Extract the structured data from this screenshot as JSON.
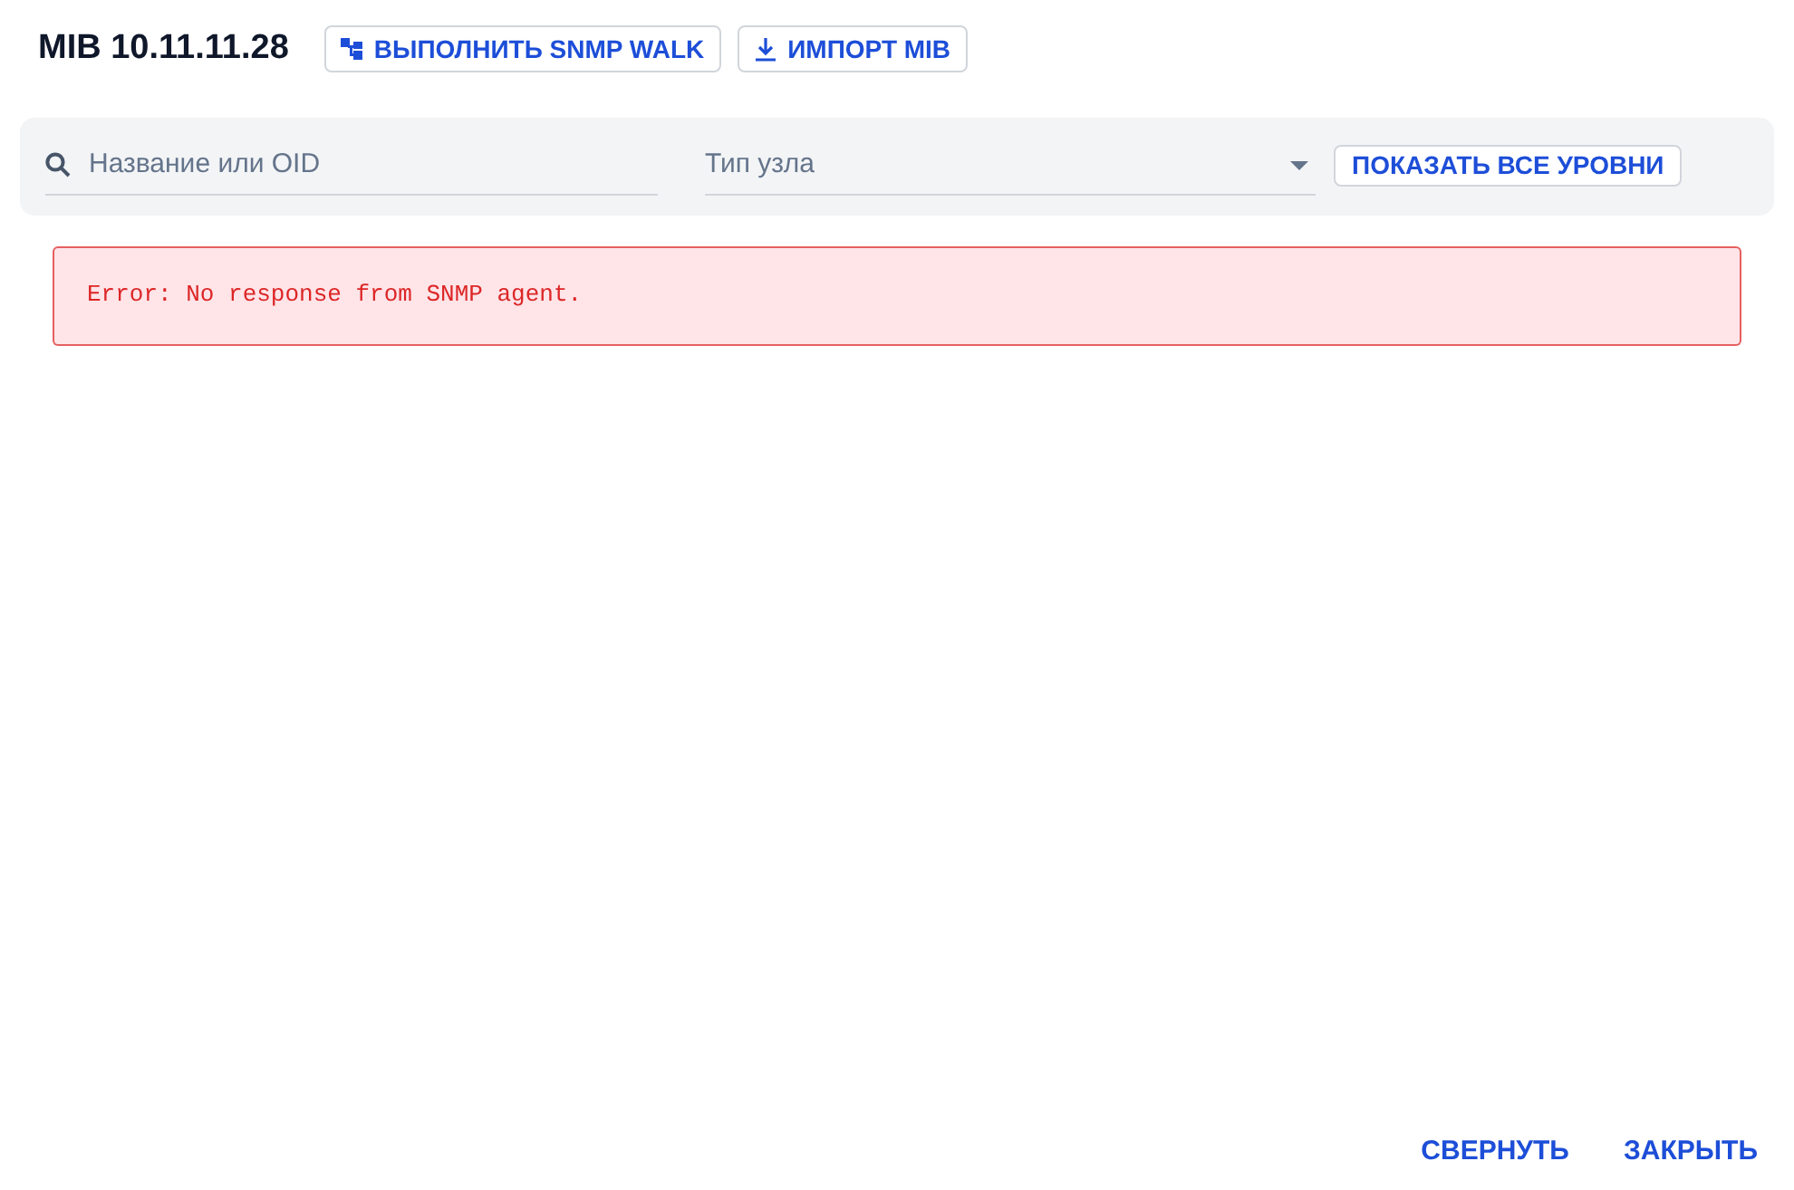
{
  "title": "MIB 10.11.11.28",
  "header_buttons": [
    {
      "label": "ВЫПОЛНИТЬ SNMP WALK",
      "kind": "walk"
    },
    {
      "label": "ИМПОРТ MIB",
      "kind": "import"
    }
  ],
  "filters": {
    "search": {
      "placeholder": "Название или OID"
    },
    "node_type": {
      "placeholder": "Тип узла"
    },
    "show_all_button": "ПОКАЗАТЬ ВСЕ УРОВНИ"
  },
  "error": "Error: No response from SNMP agent.",
  "footer_buttons": [
    "СВЕРНУТЬ",
    "ЗАКРЫТЬ"
  ]
}
